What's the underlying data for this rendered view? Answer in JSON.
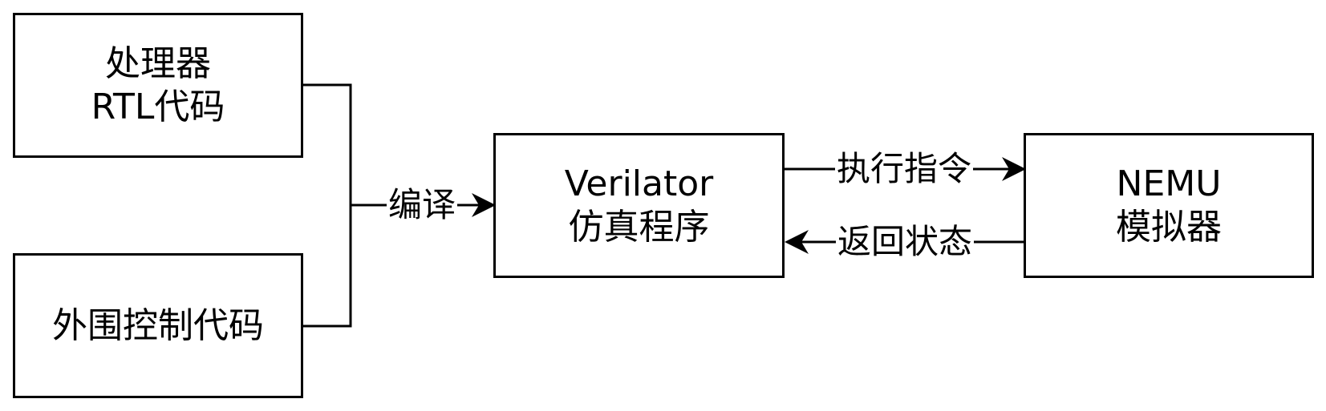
{
  "nodes": {
    "rtl": {
      "line1": "处理器",
      "line2": "RTL代码"
    },
    "periph": {
      "line1": "外围控制代码"
    },
    "verilator": {
      "line1": "Verilator",
      "line2": "仿真程序"
    },
    "nemu": {
      "line1": "NEMU",
      "line2": "模拟器"
    }
  },
  "edges": {
    "compile": "编译",
    "exec": "执行指令",
    "ret": "返回状态"
  },
  "colors": {
    "stroke": "#000000",
    "fill": "#ffffff"
  }
}
